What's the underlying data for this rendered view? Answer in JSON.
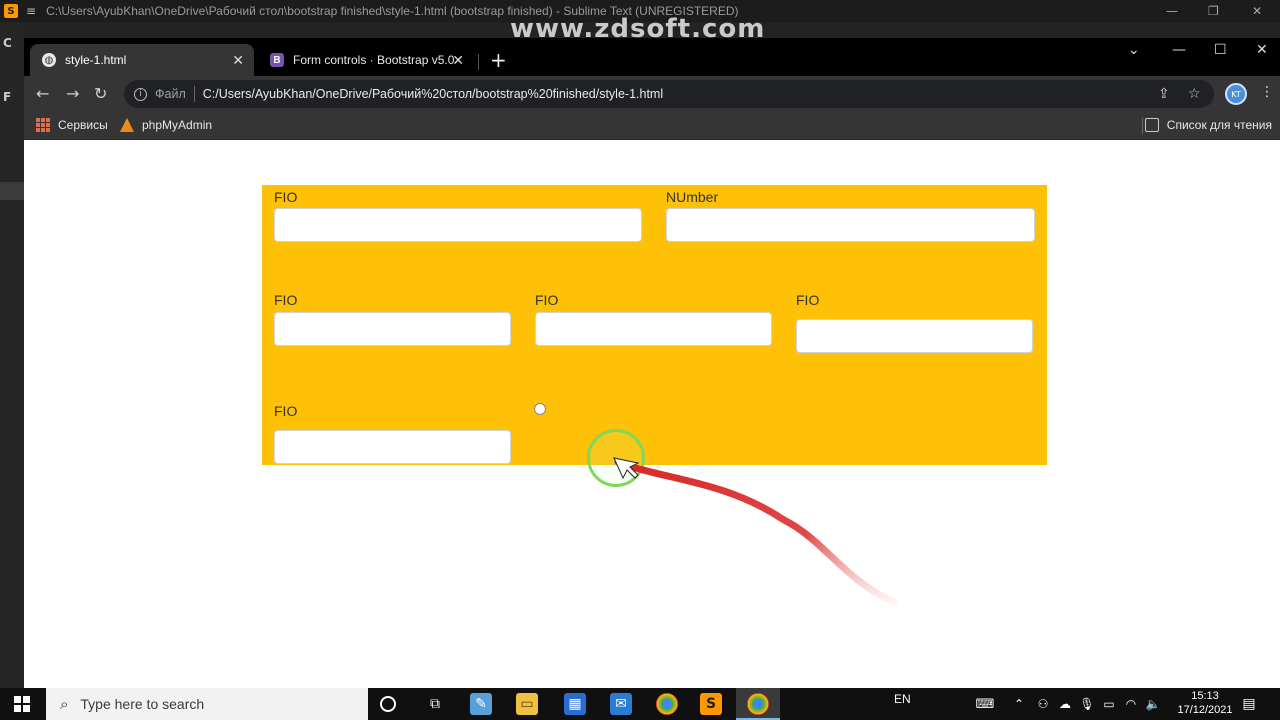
{
  "sublime": {
    "title": "C:\\Users\\AyubKhan\\OneDrive\\Рабочий стол\\bootstrap finished\\style-1.html (bootstrap finished) - Sublime Text (UNREGISTERED)",
    "left_letter_1": "C",
    "left_letter_2": "F"
  },
  "watermark": "www.zdsoft.com",
  "browser": {
    "tabs": [
      {
        "label": "style-1.html",
        "favicon": "globe-icon",
        "active": true
      },
      {
        "label": "Form controls · Bootstrap v5.0",
        "favicon": "bootstrap-icon",
        "favicon_text": "B",
        "active": false
      }
    ],
    "new_tab_label": "+",
    "address": {
      "scheme_label": "Файл",
      "url": "C:/Users/AyubKhan/OneDrive/Рабочий%20стол/bootstrap%20finished/style-1.html"
    },
    "profile_initials": "KT",
    "bookmarks": [
      {
        "label": "Сервисы",
        "icon": "apps-grid-icon"
      },
      {
        "label": "phpMyAdmin",
        "icon": "phpmyadmin-icon"
      }
    ],
    "reading_list_label": "Список для чтения"
  },
  "page": {
    "background_color": "#ffc107",
    "row1": [
      {
        "label": "FIO",
        "value": ""
      },
      {
        "label": "NUmber",
        "value": ""
      }
    ],
    "row2": [
      {
        "label": "FIO",
        "value": ""
      },
      {
        "label": "FIO",
        "value": ""
      },
      {
        "label": "FIO",
        "value": ""
      }
    ],
    "row3": [
      {
        "label": "FIO",
        "value": ""
      }
    ]
  },
  "taskbar": {
    "search_placeholder": "Type here to search",
    "language": "EN",
    "time": "15:13",
    "date": "17/12/2021"
  }
}
